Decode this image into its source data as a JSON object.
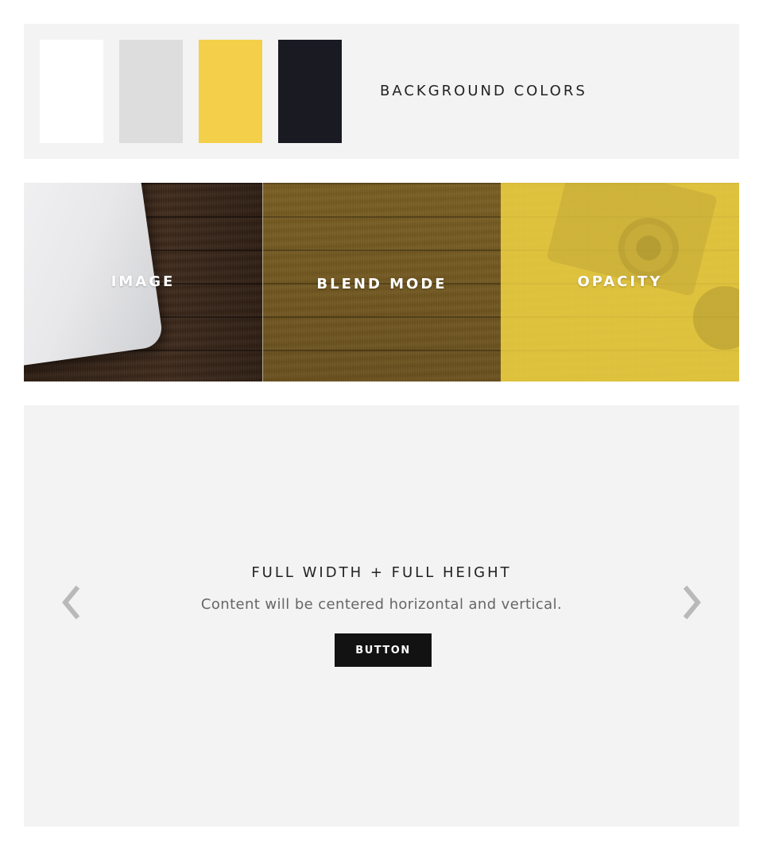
{
  "background_colors": {
    "title": "BACKGROUND COLORS",
    "swatches": [
      {
        "name": "white",
        "color": "#ffffff"
      },
      {
        "name": "light-gray",
        "color": "#dddddd"
      },
      {
        "name": "yellow",
        "color": "#f3cf4a"
      },
      {
        "name": "dark-navy",
        "color": "#1a1a23"
      }
    ]
  },
  "tiles": [
    {
      "label": "IMAGE"
    },
    {
      "label": "BLEND MODE"
    },
    {
      "label": "OPACITY"
    }
  ],
  "hero": {
    "title": "FULL WIDTH + FULL HEIGHT",
    "subtitle": "Content will be centered horizontal and vertical.",
    "button_label": "BUTTON",
    "prev_icon": "chevron-left-icon",
    "next_icon": "chevron-right-icon",
    "arrow_color": "#b9b9b9"
  }
}
